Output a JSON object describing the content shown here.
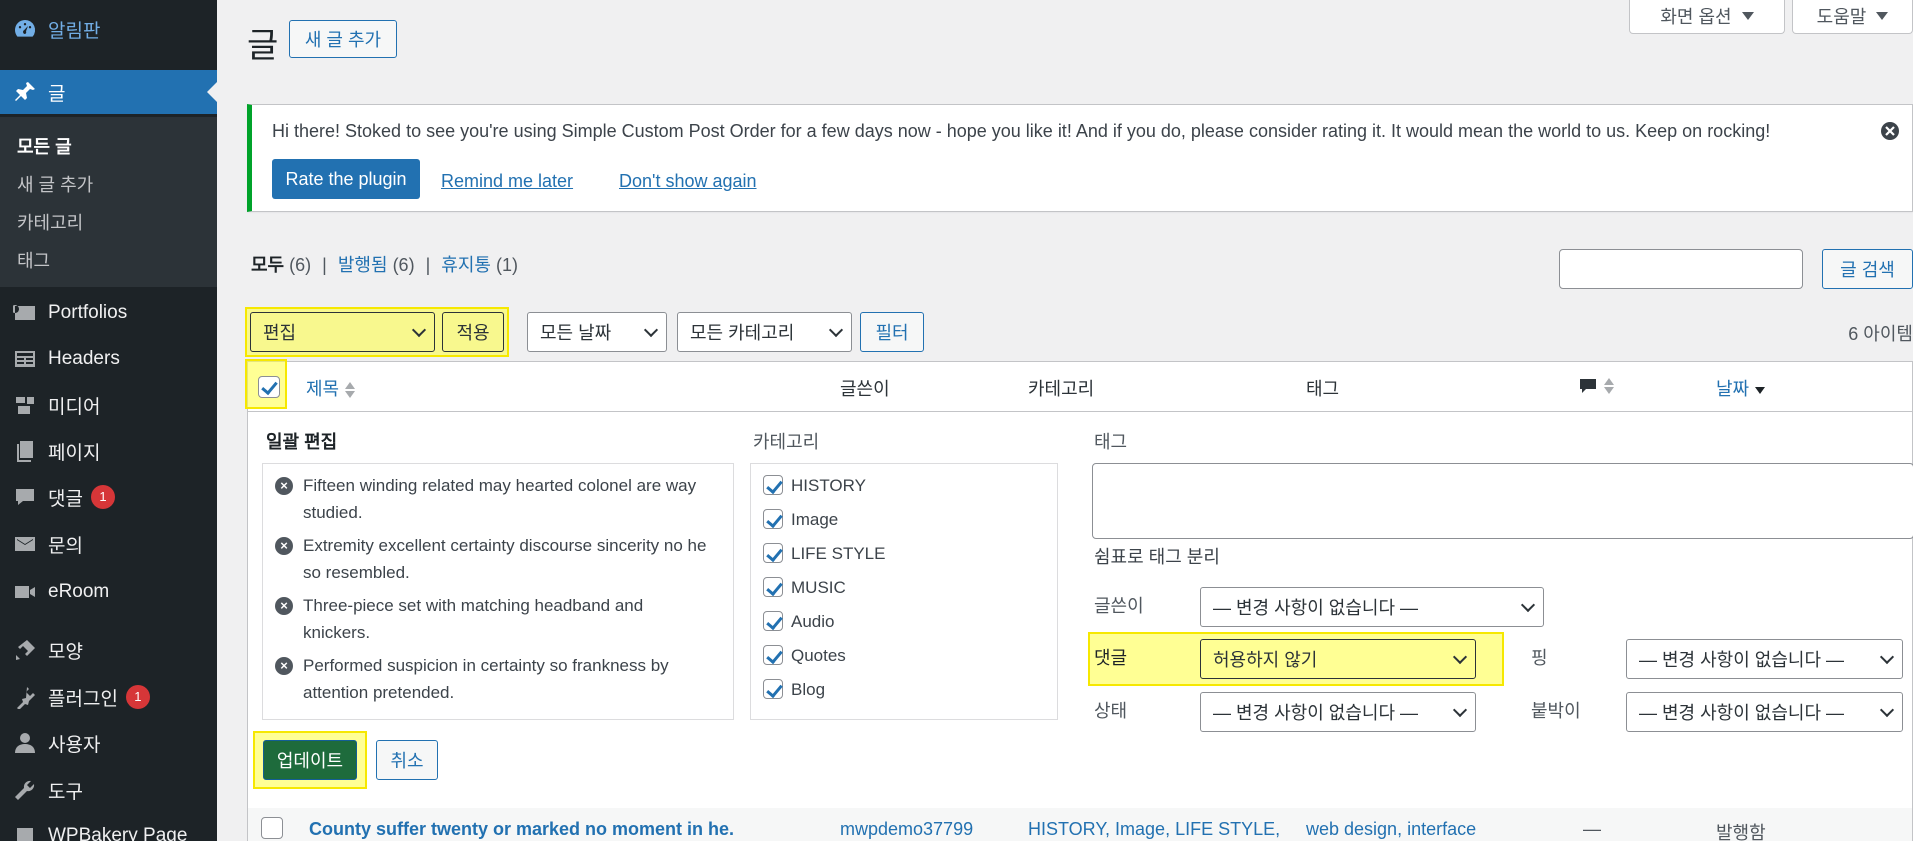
{
  "sidebar": {
    "items": [
      {
        "label": "알림판",
        "icon": "dashboard-icon"
      },
      {
        "label": "글",
        "icon": "pin-icon"
      },
      {
        "label": "Portfolios",
        "icon": "portfolio-icon"
      },
      {
        "label": "Headers",
        "icon": "headers-icon"
      },
      {
        "label": "미디어",
        "icon": "media-icon"
      },
      {
        "label": "페이지",
        "icon": "page-icon"
      },
      {
        "label": "댓글",
        "icon": "comment-icon",
        "badge": "1"
      },
      {
        "label": "문의",
        "icon": "mail-icon"
      },
      {
        "label": "eRoom",
        "icon": "video-icon"
      },
      {
        "label": "모양",
        "icon": "appearance-icon"
      },
      {
        "label": "플러그인",
        "icon": "plugin-icon",
        "badge": "1"
      },
      {
        "label": "사용자",
        "icon": "user-icon"
      },
      {
        "label": "도구",
        "icon": "tools-icon"
      },
      {
        "label": "WPBakery Page",
        "icon": "wpbakery-icon"
      }
    ],
    "submenu": [
      "모든 글",
      "새 글 추가",
      "카테고리",
      "태그"
    ]
  },
  "header": {
    "title": "글",
    "add_new": "새 글 추가",
    "screen_options": "화면 옵션",
    "help": "도움말"
  },
  "notice": {
    "message": "Hi there! Stoked to see you're using Simple Custom Post Order for a few days now - hope you like it! And if you do, please consider rating it. It would mean the world to us. Keep on rocking!",
    "rate": "Rate the plugin",
    "remind": "Remind me later",
    "dont_show": "Don't show again"
  },
  "views": {
    "all": "모두",
    "all_count": "(6)",
    "published": "발행됨",
    "published_count": "(6)",
    "trash": "휴지통",
    "trash_count": "(1)",
    "sep": "|"
  },
  "search": {
    "button": "글 검색",
    "value": ""
  },
  "bulk": {
    "action": "편집",
    "apply": "적용"
  },
  "filters": {
    "date": "모든 날짜",
    "category": "모든 카테고리",
    "filter_button": "필터"
  },
  "items_count": "6 아이템",
  "columns": {
    "title": "제목",
    "author": "글쓴이",
    "categories": "카테고리",
    "tags": "태그",
    "date": "날짜"
  },
  "bulk_edit": {
    "heading": "일괄 편집",
    "categories_label": "카테고리",
    "tags_label": "태그",
    "tags_hint": "쉼표로 태그 분리",
    "posts": [
      {
        "line1": "Fifteen winding related may hearted colonel are way",
        "line2": "studied."
      },
      {
        "line1": "Extremity excellent certainty discourse sincerity no he",
        "line2": "so resembled."
      },
      {
        "line1": "Three-piece set with matching headband and",
        "line2": "knickers."
      },
      {
        "line1": "Performed suspicion in certainty so frankness by",
        "line2": "attention pretended."
      }
    ],
    "categories": [
      "HISTORY",
      "Image",
      "LIFE STYLE",
      "MUSIC",
      "Audio",
      "Quotes",
      "Blog"
    ],
    "author_label": "글쓴이",
    "author_value": "— 변경 사항이 없습니다 —",
    "comments_label": "댓글",
    "comments_value": "허용하지 않기",
    "ping_label": "핑",
    "ping_value": "— 변경 사항이 없습니다 —",
    "status_label": "상태",
    "status_value": "— 변경 사항이 없습니다 —",
    "sticky_label": "붙박이",
    "sticky_value": "— 변경 사항이 없습니다 —",
    "update": "업데이트",
    "cancel": "취소"
  },
  "row": {
    "title": "County suffer twenty or marked no moment in he.",
    "author": "mwpdemo37799",
    "categories": "HISTORY, Image, LIFE STYLE,",
    "tags": "web design, interface",
    "comments": "—",
    "date_status": "발행함"
  }
}
